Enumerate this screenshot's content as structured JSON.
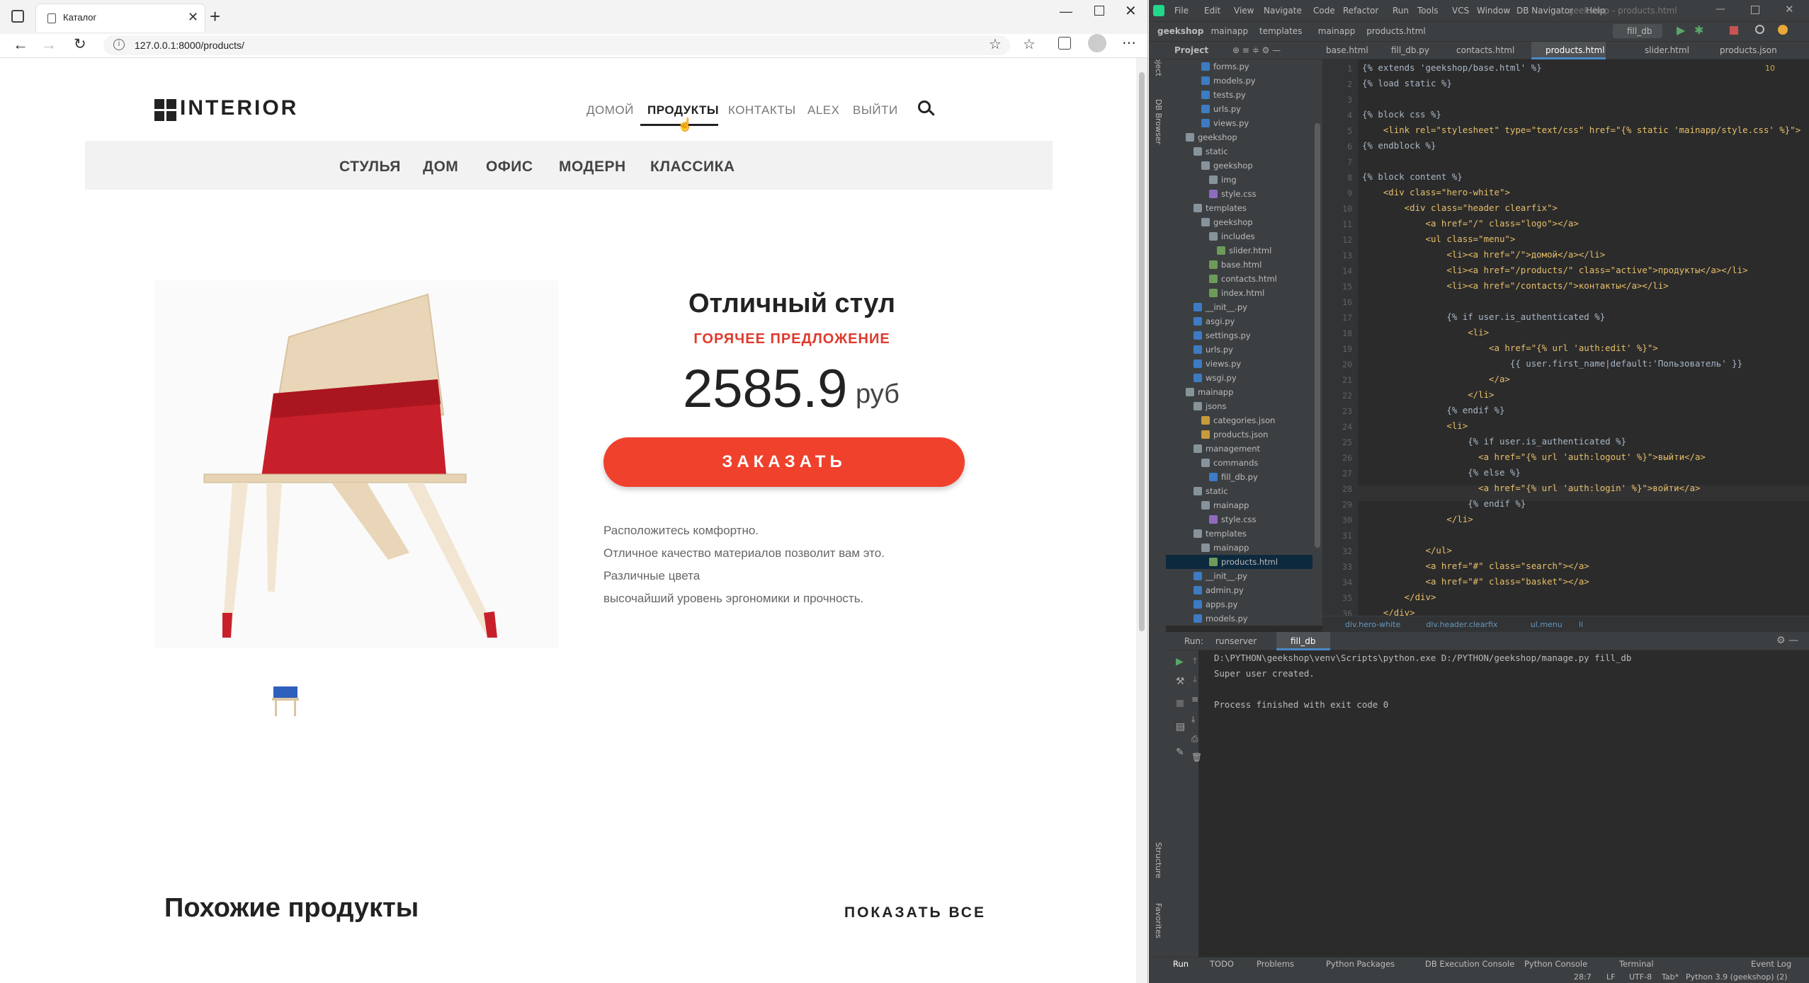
{
  "browser": {
    "tab_title": "Каталог",
    "url": "127.0.0.1:8000/products/"
  },
  "site": {
    "logo": "INTERIOR",
    "nav": [
      "ДОМОЙ",
      "ПРОДУКТЫ",
      "КОНТАКТЫ",
      "ALEX",
      "ВЫЙТИ"
    ],
    "categories": [
      "СТУЛЬЯ",
      "ДОМ",
      "ОФИС",
      "МОДЕРН",
      "КЛАССИКА"
    ],
    "product_title": "Отличный стул",
    "hot_offer": "ГОРЯЧЕЕ ПРЕДЛОЖЕНИЕ",
    "price": "2585.9",
    "currency": "руб",
    "order_button": "ЗАКАЗАТЬ",
    "description": [
      "Расположитесь комфортно.",
      "Отличное качество материалов позволит вам это.",
      "Различные цвета",
      "высочайший уровень эргономики и прочность."
    ],
    "similar_title": "Похожие продукты",
    "show_all": "ПОКАЗАТЬ ВСЕ"
  },
  "ide": {
    "menu": [
      "File",
      "Edit",
      "View",
      "Navigate",
      "Code",
      "Refactor",
      "Run",
      "Tools",
      "VCS",
      "Window",
      "DB Navigator",
      "Help"
    ],
    "window_title": "geekshop - products.html",
    "breadcrumb": [
      "geekshop",
      "mainapp",
      "templates",
      "mainapp",
      "products.html"
    ],
    "run_config": "fill_db",
    "tabs": [
      "base.html",
      "fill_db.py",
      "contacts.html",
      "products.html",
      "slider.html",
      "products.json"
    ],
    "project_label": "Project",
    "warnings": "10",
    "tree": [
      [
        "forms.py",
        "py",
        4
      ],
      [
        "models.py",
        "py",
        4
      ],
      [
        "tests.py",
        "py",
        4
      ],
      [
        "urls.py",
        "py",
        4
      ],
      [
        "views.py",
        "py",
        4
      ],
      [
        "geekshop",
        "fo",
        2
      ],
      [
        "static",
        "fo",
        3
      ],
      [
        "geekshop",
        "fo",
        4
      ],
      [
        "img",
        "fo",
        5
      ],
      [
        "style.css",
        "css",
        5
      ],
      [
        "templates",
        "fo",
        3
      ],
      [
        "geekshop",
        "fo",
        4
      ],
      [
        "includes",
        "fo",
        5
      ],
      [
        "slider.html",
        "htm",
        6
      ],
      [
        "base.html",
        "htm",
        5
      ],
      [
        "contacts.html",
        "htm",
        5
      ],
      [
        "index.html",
        "htm",
        5
      ],
      [
        "__init__.py",
        "py",
        3
      ],
      [
        "asgi.py",
        "py",
        3
      ],
      [
        "settings.py",
        "py",
        3
      ],
      [
        "urls.py",
        "py",
        3
      ],
      [
        "views.py",
        "py",
        3
      ],
      [
        "wsgi.py",
        "py",
        3
      ],
      [
        "mainapp",
        "fo",
        2
      ],
      [
        "jsons",
        "fo",
        3
      ],
      [
        "categories.json",
        "js",
        4
      ],
      [
        "products.json",
        "js",
        4
      ],
      [
        "management",
        "fo",
        3
      ],
      [
        "commands",
        "fo",
        4
      ],
      [
        "fill_db.py",
        "py",
        5
      ],
      [
        "static",
        "fo",
        3
      ],
      [
        "mainapp",
        "fo",
        4
      ],
      [
        "style.css",
        "css",
        5
      ],
      [
        "templates",
        "fo",
        3
      ],
      [
        "mainapp",
        "fo",
        4
      ],
      [
        "products.html",
        "htm",
        5
      ],
      [
        "__init__.py",
        "py",
        3
      ],
      [
        "admin.py",
        "py",
        3
      ],
      [
        "apps.py",
        "py",
        3
      ],
      [
        "models.py",
        "py",
        3
      ]
    ],
    "code": [
      "{% extends 'geekshop/base.html' %}",
      "{% load static %}",
      "",
      "{% block css %}",
      "    <link rel=\"stylesheet\" type=\"text/css\" href=\"{% static 'mainapp/style.css' %}\">",
      "{% endblock %}",
      "",
      "{% block content %}",
      "    <div class=\"hero-white\">",
      "        <div class=\"header clearfix\">",
      "            <a href=\"/\" class=\"logo\"></a>",
      "            <ul class=\"menu\">",
      "                <li><a href=\"/\">домой</a></li>",
      "                <li><a href=\"/products/\" class=\"active\">продукты</a></li>",
      "                <li><a href=\"/contacts/\">контакты</a></li>",
      "",
      "                {% if user.is_authenticated %}",
      "                    <li>",
      "                        <a href=\"{% url 'auth:edit' %}\">",
      "                            {{ user.first_name|default:'Пользователь' }}",
      "                        </a>",
      "                    </li>",
      "                {% endif %}",
      "                <li>",
      "                    {% if user.is_authenticated %}",
      "                      <a href=\"{% url 'auth:logout' %}\">выйти</a>",
      "                    {% else %}",
      "                      <a href=\"{% url 'auth:login' %}\">войти</a>",
      "                    {% endif %}",
      "                </li>",
      "",
      "            </ul>",
      "            <a href=\"#\" class=\"search\"></a>",
      "            <a href=\"#\" class=\"basket\"></a>",
      "        </div>",
      "    </div>"
    ],
    "code_breadcrumb": [
      "div.hero-white",
      "div.header.clearfix",
      "ul.menu",
      "li"
    ],
    "run": {
      "label": "Run:",
      "tabs": [
        "runserver",
        "fill_db"
      ],
      "lines": [
        "D:\\PYTHON\\geekshop\\venv\\Scripts\\python.exe D:/PYTHON/geekshop/manage.py fill_db",
        "Super user created.",
        "",
        "Process finished with exit code 0"
      ]
    },
    "bottom_tabs": [
      "Run",
      "TODO",
      "Problems",
      "Python Packages",
      "DB Execution Console",
      "Python Console",
      "Terminal"
    ],
    "event_log": "Event Log",
    "status": [
      "28:7",
      "LF",
      "UTF-8",
      "Tab*",
      "Python 3.9 (geekshop) (2)"
    ],
    "side_labels": [
      "Project",
      "DB Browser",
      "Structure",
      "Favorites"
    ]
  }
}
